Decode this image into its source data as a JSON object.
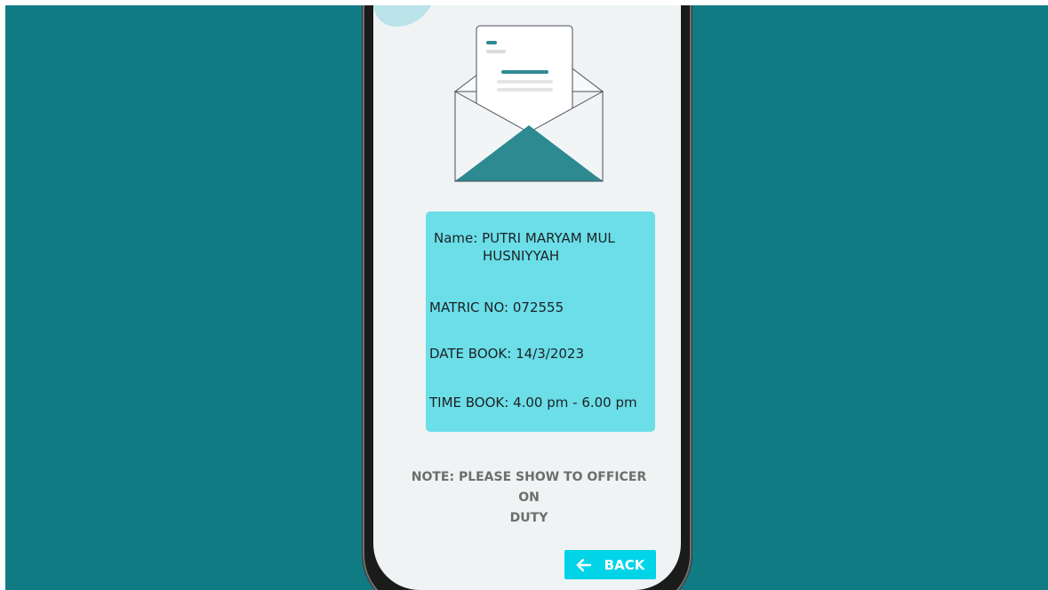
{
  "booking": {
    "name_line1": "Name: PUTRI MARYAM MUL",
    "name_line2": "HUSNIYYAH",
    "matric": "MATRIC NO: 072555",
    "date": "DATE BOOK: 14/3/2023",
    "time": "TIME BOOK: 4.00 pm - 6.00 pm"
  },
  "note": {
    "line1": "NOTE: PLEASE SHOW TO OFFICER ON",
    "line2": "DUTY"
  },
  "back_button": {
    "label": "BACK",
    "icon": "arrow-left-icon"
  },
  "illustration": {
    "icon": "open-envelope-icon"
  },
  "colors": {
    "background": "#117b84",
    "screen": "#eff3f4",
    "card": "#6bdee8",
    "button": "#00d4e6",
    "envelope_accent": "#2e8a91"
  }
}
